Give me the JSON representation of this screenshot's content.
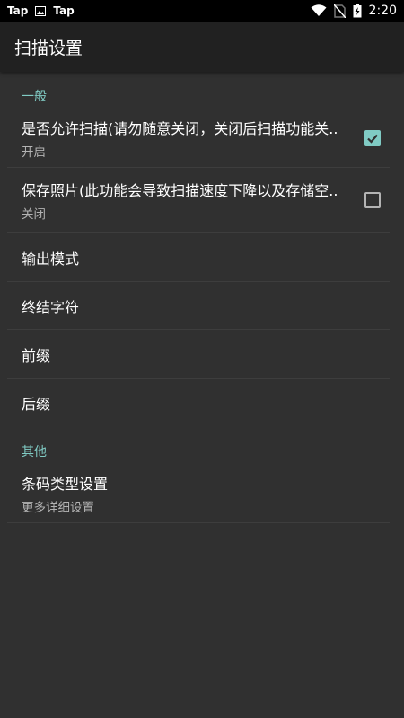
{
  "status_bar": {
    "notifications": [
      "Tap",
      "Tap"
    ],
    "time": "2:20",
    "icons": [
      "image-icon",
      "wifi-icon",
      "no-sim-icon",
      "battery-charging-icon"
    ]
  },
  "toolbar": {
    "title": "扫描设置"
  },
  "sections": [
    {
      "category": "一般",
      "prefs": [
        {
          "title": "是否允许扫描(请勿随意关闭，关闭后扫描功能关..",
          "summary": "开启",
          "checked": true
        },
        {
          "title": "保存照片(此功能会导致扫描速度下降以及存储空..",
          "summary": "关闭",
          "checked": false
        },
        {
          "title": "输出模式"
        },
        {
          "title": "终结字符"
        },
        {
          "title": "前缀"
        },
        {
          "title": "后缀"
        }
      ]
    },
    {
      "category": "其他",
      "prefs": [
        {
          "title": "条码类型设置",
          "summary": "更多详细设置"
        }
      ]
    }
  ],
  "colors": {
    "accent": "#80cbc4",
    "background": "#303030",
    "toolbar": "#212121"
  }
}
